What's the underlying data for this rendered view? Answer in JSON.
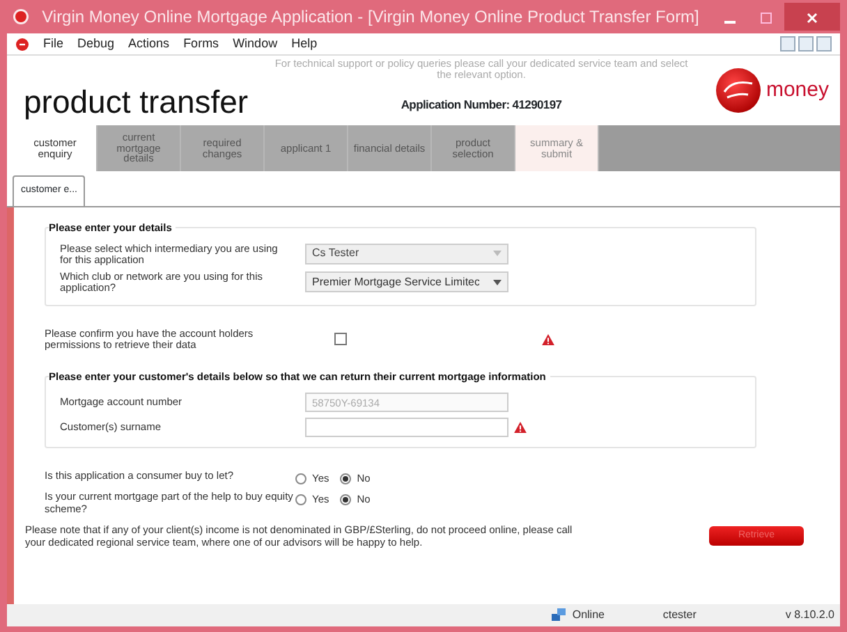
{
  "window": {
    "title": "Virgin Money Online Mortgage Application - [Virgin Money Online Product Transfer Form]"
  },
  "menu": [
    "File",
    "Debug",
    "Actions",
    "Forms",
    "Window",
    "Help"
  ],
  "header": {
    "title": "product transfer",
    "support_note": "For technical support or policy queries please call your dedicated service team and select the relevant option.",
    "application_number": "Application Number: 41290197",
    "brand": "money"
  },
  "tabs": [
    {
      "label": "customer enquiry",
      "selected": true,
      "kind": "step"
    },
    {
      "label": "current mortgage details",
      "selected": false,
      "kind": "step"
    },
    {
      "label": "required changes",
      "selected": false,
      "kind": "step"
    },
    {
      "label": "applicant 1",
      "selected": false,
      "kind": "step"
    },
    {
      "label": "financial details",
      "selected": false,
      "kind": "step"
    },
    {
      "label": "product selection",
      "selected": false,
      "kind": "step"
    },
    {
      "label": "summary & submit",
      "selected": false,
      "kind": "submit"
    }
  ],
  "sub_tab": {
    "label": "customer e..."
  },
  "details_group": {
    "title": "Please enter your details",
    "rows": [
      {
        "label": "Please select which intermediary you are using for this application",
        "value": "Cs Tester",
        "disabled": true
      },
      {
        "label": "Which club or network are you using for this application?",
        "value": "Premier Mortgage Service Limitec",
        "disabled": false
      }
    ]
  },
  "permission": {
    "label": "Please confirm you have the account holders permissions to retrieve their data",
    "checked": false,
    "warning": true
  },
  "customer_group": {
    "title": "Please enter your customer's details below so that we can return their current mortgage information",
    "fields": [
      {
        "label": "Mortgage account number",
        "value": "58750Y-69134",
        "disabled": true,
        "warning": false
      },
      {
        "label": "Customer(s) surname",
        "disabled": false,
        "warning": true
      }
    ]
  },
  "questions": [
    {
      "label": "Is this application a consumer buy to let?",
      "options": [
        {
          "label": "Yes",
          "selected": false
        },
        {
          "label": "No",
          "selected": true
        }
      ]
    },
    {
      "label": "Is your current mortgage part of the help to buy equity scheme?",
      "options": [
        {
          "label": "Yes",
          "selected": false
        },
        {
          "label": "No",
          "selected": true
        }
      ]
    }
  ],
  "notice": "Please note that if any of your client(s) income is not denominated in GBP/£Sterling, do not proceed online, please call your dedicated regional service team, where one of our advisors will be happy to help.",
  "retrieve_button": {
    "label": "Retrieve",
    "disabled": true
  },
  "status_bar": {
    "connection": "Online",
    "user": "ctester",
    "version": "v 8.10.2.0"
  }
}
